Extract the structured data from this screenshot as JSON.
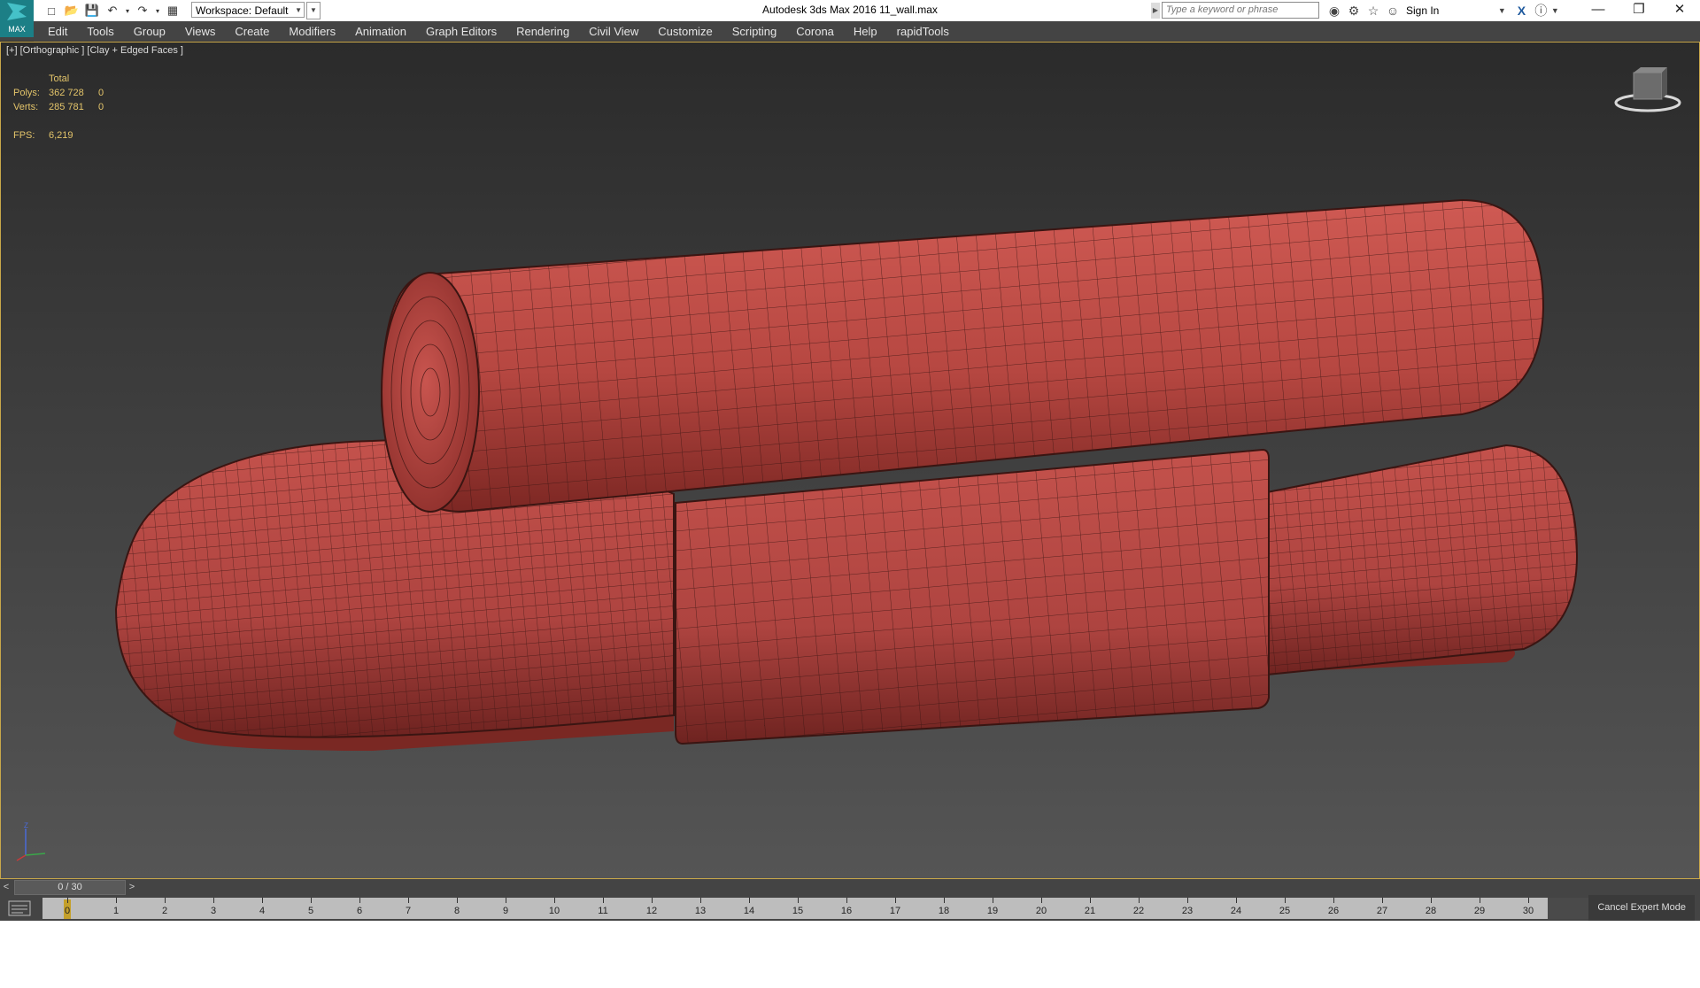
{
  "app": {
    "logo_text": "MAX",
    "window_title": "Autodesk 3ds Max 2016    11_wall.max"
  },
  "workspace": {
    "label": "Workspace: Default"
  },
  "search": {
    "placeholder": "Type a keyword or phrase"
  },
  "signin": {
    "label": "Sign In"
  },
  "menu": [
    "Edit",
    "Tools",
    "Group",
    "Views",
    "Create",
    "Modifiers",
    "Animation",
    "Graph Editors",
    "Rendering",
    "Civil View",
    "Customize",
    "Scripting",
    "Corona",
    "Help",
    "rapidTools"
  ],
  "viewport": {
    "label": "[+] [Orthographic ] [Clay + Edged Faces ]",
    "stats": {
      "header": "Total",
      "polys_label": "Polys:",
      "polys_total": "362 728",
      "polys_sel": "0",
      "verts_label": "Verts:",
      "verts_total": "285 781",
      "verts_sel": "0",
      "fps_label": "FPS:",
      "fps_value": "6,219"
    },
    "model_color": "#b94a45",
    "edge_color": "#3a1512",
    "axis_labels": {
      "z": "Z",
      "x": "x",
      "y": "y"
    }
  },
  "timeslider": {
    "prev": "<",
    "next": ">",
    "frame": "0 / 30"
  },
  "trackbar": {
    "ticks": [
      "0",
      "1",
      "2",
      "3",
      "4",
      "5",
      "6",
      "7",
      "8",
      "9",
      "10",
      "11",
      "12",
      "13",
      "14",
      "15",
      "16",
      "17",
      "18",
      "19",
      "20",
      "21",
      "22",
      "23",
      "24",
      "25",
      "26",
      "27",
      "28",
      "29",
      "30"
    ],
    "current_frame": 0
  },
  "statusbar": {
    "cancel_expert": "Cancel Expert Mode"
  }
}
